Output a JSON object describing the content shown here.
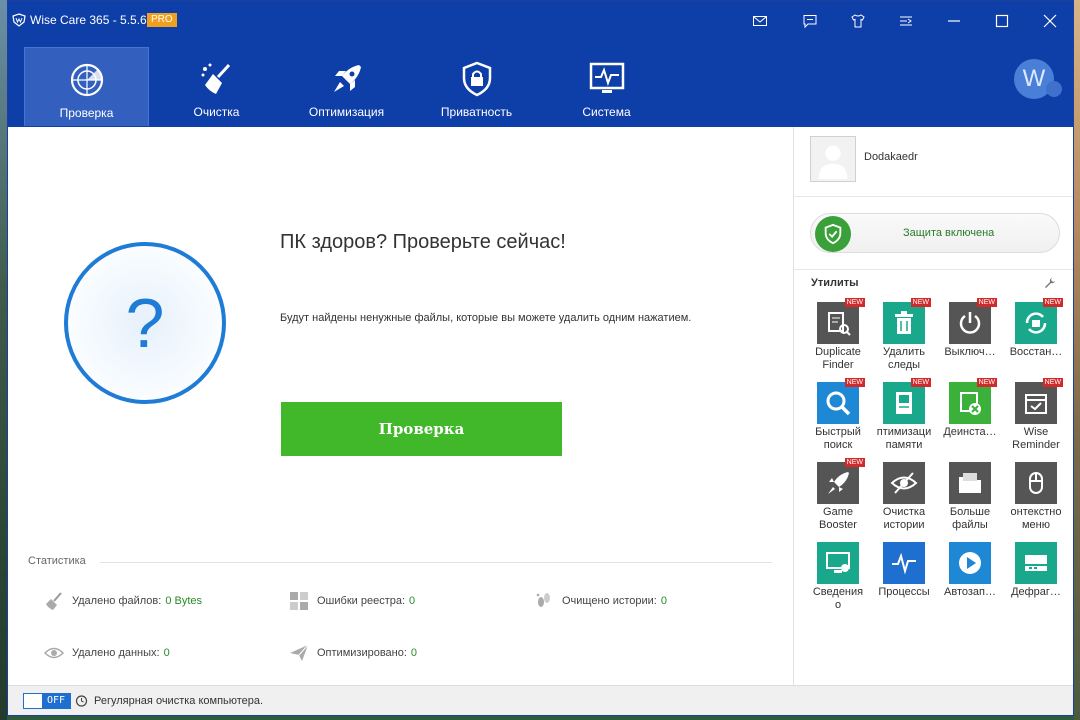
{
  "window": {
    "title": "Wise Care 365 - 5.5.6",
    "edition_badge": "PRO",
    "avatar_letter": "W"
  },
  "nav": [
    {
      "id": "check",
      "label": "Проверка",
      "active": true
    },
    {
      "id": "clean",
      "label": "Очистка",
      "active": false
    },
    {
      "id": "optimize",
      "label": "Оптимизация",
      "active": false
    },
    {
      "id": "privacy",
      "label": "Приватность",
      "active": false
    },
    {
      "id": "system",
      "label": "Система",
      "active": false
    }
  ],
  "main": {
    "headline": "ПК здоров? Проверьте сейчас!",
    "subtext": "Будут найдены ненужные файлы, которые вы можете удалить одним нажатием.",
    "scan_button": "Проверка",
    "question_mark": "?"
  },
  "stats": {
    "title": "Статистика",
    "items": [
      {
        "label": "Удалено файлов:",
        "value": "0 Bytes"
      },
      {
        "label": "Ошибки реестра:",
        "value": "0"
      },
      {
        "label": "Очищено истории:",
        "value": "0"
      },
      {
        "label": "Удалено данных:",
        "value": "0"
      },
      {
        "label": "Оптимизировано:",
        "value": "0"
      }
    ]
  },
  "sidebar": {
    "username": "Dodakaedr",
    "protection": "Защита включена",
    "utilities_title": "Утилиты",
    "new_badge": "NEW",
    "tools": [
      {
        "label": "Duplicate\nFinder",
        "icon": "duplicate-finder-icon",
        "color": "#555555",
        "new": true
      },
      {
        "label": "Удалить\nследы",
        "icon": "trash-icon",
        "color": "#1aa88c",
        "new": true
      },
      {
        "label": "Выключ…",
        "icon": "power-icon",
        "color": "#555555",
        "new": true
      },
      {
        "label": "Восстан…",
        "icon": "restore-icon",
        "color": "#1aa88c",
        "new": true
      },
      {
        "label": "Быстрый\nпоиск",
        "icon": "search-icon",
        "color": "#1e88d4",
        "new": true
      },
      {
        "label": "птимизаци\nпамяти",
        "icon": "memory-icon",
        "color": "#1aa88c",
        "new": true
      },
      {
        "label": "Деинста…",
        "icon": "uninstall-icon",
        "color": "#3bb03b",
        "new": true
      },
      {
        "label": "Wise\nReminder",
        "icon": "reminder-icon",
        "color": "#555555",
        "new": true
      },
      {
        "label": "Game\nBooster",
        "icon": "rocket-icon",
        "color": "#555555",
        "new": true
      },
      {
        "label": "Очистка\nистории",
        "icon": "eye-off-icon",
        "color": "#555555",
        "new": false
      },
      {
        "label": "Больше\nфайлы",
        "icon": "folder-icon",
        "color": "#555555",
        "new": false
      },
      {
        "label": "онтекстно\nменю",
        "icon": "mouse-icon",
        "color": "#555555",
        "new": false
      },
      {
        "label": "Сведения\nо",
        "icon": "monitor-gear-icon",
        "color": "#1aa88c",
        "new": false
      },
      {
        "label": "Процессы",
        "icon": "pulse-icon",
        "color": "#1e6fd0",
        "new": false
      },
      {
        "label": "Автозап…",
        "icon": "play-icon",
        "color": "#1e88d4",
        "new": false
      },
      {
        "label": "Дефраг…",
        "icon": "drive-icon",
        "color": "#1aa88c",
        "new": false
      }
    ]
  },
  "footer": {
    "toggle_state": "OFF",
    "text": "Регулярная очистка компьютера."
  }
}
